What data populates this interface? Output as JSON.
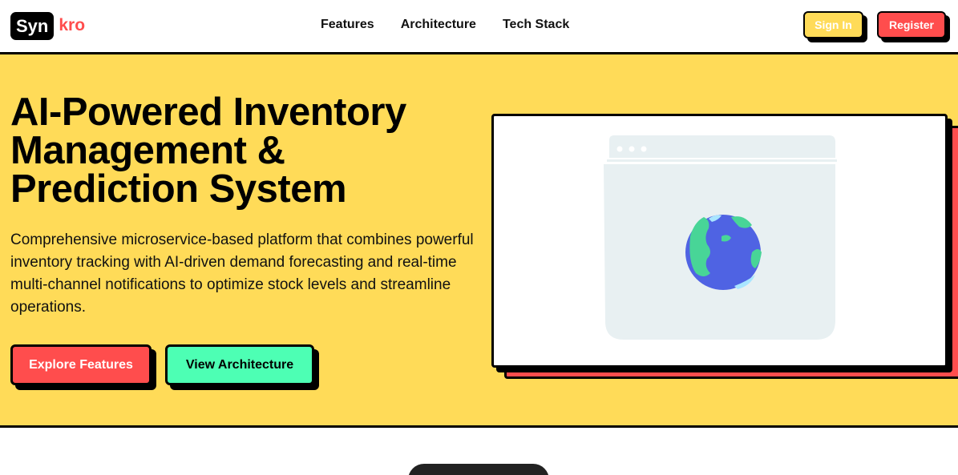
{
  "nav": {
    "logo_box": "Syn",
    "logo_rest": "kro",
    "links": [
      "Features",
      "Architecture",
      "Tech Stack"
    ],
    "signin_label": "Sign In",
    "register_label": "Register"
  },
  "hero": {
    "title_lines": [
      "AI-Powered Inventory",
      "Management &",
      "Prediction System"
    ],
    "description": "Comprehensive microservice-based platform that combines powerful inventory tracking with AI-driven demand forecasting and real-time multi-channel notifications to optimize stock levels and streamline operations.",
    "explore_label": "Explore Features",
    "architecture_label": "View Architecture"
  },
  "illustration": {
    "icon": "globe-in-browser-window-icon"
  },
  "colors": {
    "yellow": "#ffdb58",
    "red": "#ff4d4d",
    "mint": "#4dffb4",
    "black": "#000000"
  }
}
